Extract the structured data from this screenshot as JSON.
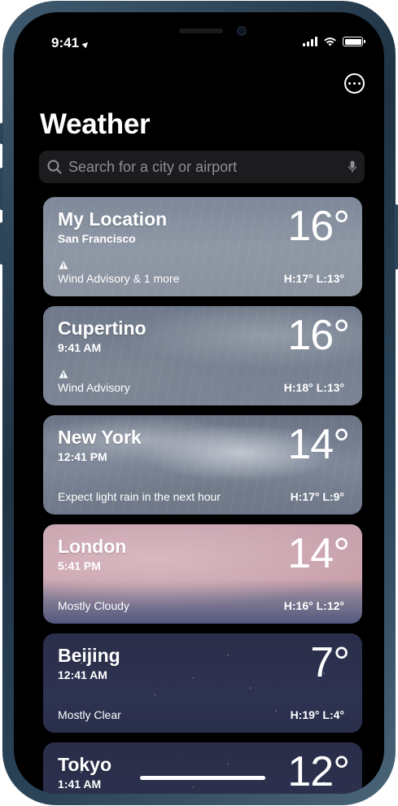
{
  "status_bar": {
    "time": "9:41",
    "location_arrow": "location-arrow-icon",
    "icons": [
      "cellular-signal-icon",
      "wifi-icon",
      "battery-icon"
    ]
  },
  "header": {
    "more_icon": "ellipsis-circle-icon",
    "title": "Weather"
  },
  "search": {
    "placeholder": "Search for a city or airport",
    "value": "",
    "icon": "search-icon",
    "mic_icon": "microphone-icon"
  },
  "cities": [
    {
      "name": "My Location",
      "subtitle": "San Francisco",
      "temp": "16°",
      "alert": true,
      "condition": "Wind Advisory & 1 more",
      "hilo": "H:17°  L:13°"
    },
    {
      "name": "Cupertino",
      "subtitle": "9:41 AM",
      "temp": "16°",
      "alert": true,
      "condition": "Wind Advisory",
      "hilo": "H:18°  L:13°"
    },
    {
      "name": "New York",
      "subtitle": "12:41 PM",
      "temp": "14°",
      "alert": false,
      "condition": "Expect light rain in the next hour",
      "hilo": "H:17°  L:9°"
    },
    {
      "name": "London",
      "subtitle": "5:41 PM",
      "temp": "14°",
      "alert": false,
      "condition": "Mostly Cloudy",
      "hilo": "H:16°  L:12°"
    },
    {
      "name": "Beijing",
      "subtitle": "12:41 AM",
      "temp": "7°",
      "alert": false,
      "condition": "Mostly Clear",
      "hilo": "H:19°  L:4°"
    },
    {
      "name": "Tokyo",
      "subtitle": "1:41 AM",
      "temp": "12°",
      "alert": false,
      "condition": "",
      "hilo": ""
    }
  ],
  "colors": {
    "screen_background": "#000000",
    "search_background": "#1c1c1e",
    "placeholder": "#8e8e93",
    "phone_frame": "#2b4458"
  }
}
